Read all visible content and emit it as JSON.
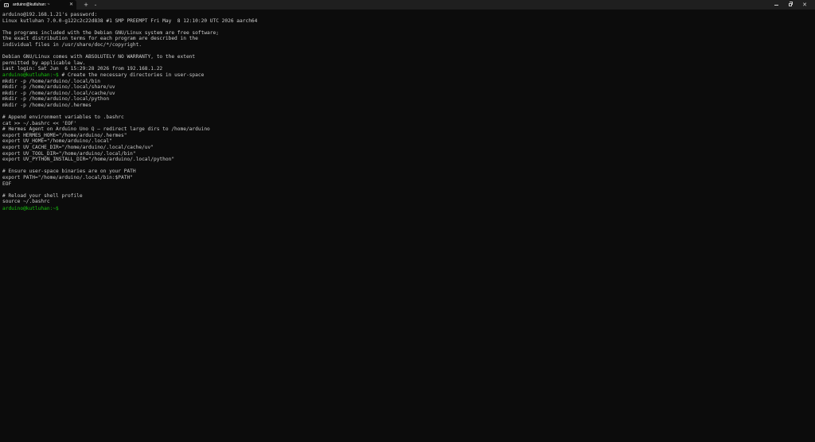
{
  "tab": {
    "title": "arduino@kutluhan: ~",
    "close_glyph": "✕",
    "icon": "terminal-icon"
  },
  "titlebar": {
    "new_tab_glyph": "+",
    "dropdown_glyph": "⌄",
    "close_glyph": "✕"
  },
  "terminal": {
    "lines": [
      {
        "prompt": "",
        "text": "arduino@192.168.1.21's password:"
      },
      {
        "prompt": "",
        "text": "Linux kutluhan 7.0.0-g122c2c22d838 #1 SMP PREEMPT Fri May  8 12:10:20 UTC 2026 aarch64"
      },
      {
        "prompt": "",
        "text": ""
      },
      {
        "prompt": "",
        "text": "The programs included with the Debian GNU/Linux system are free software;"
      },
      {
        "prompt": "",
        "text": "the exact distribution terms for each program are described in the"
      },
      {
        "prompt": "",
        "text": "individual files in /usr/share/doc/*/copyright."
      },
      {
        "prompt": "",
        "text": ""
      },
      {
        "prompt": "",
        "text": "Debian GNU/Linux comes with ABSOLUTELY NO WARRANTY, to the extent"
      },
      {
        "prompt": "",
        "text": "permitted by applicable law."
      },
      {
        "prompt": "",
        "text": "Last login: Sat Jun  6 15:29:28 2026 from 192.168.1.22"
      },
      {
        "prompt": "arduino@kutluhan:~$",
        "text": " # Create the necessary directories in user-space"
      },
      {
        "prompt": "",
        "text": "mkdir -p /home/arduino/.local/bin"
      },
      {
        "prompt": "",
        "text": "mkdir -p /home/arduino/.local/share/uv"
      },
      {
        "prompt": "",
        "text": "mkdir -p /home/arduino/.local/cache/uv"
      },
      {
        "prompt": "",
        "text": "mkdir -p /home/arduino/.local/python"
      },
      {
        "prompt": "",
        "text": "mkdir -p /home/arduino/.hermes"
      },
      {
        "prompt": "",
        "text": ""
      },
      {
        "prompt": "",
        "text": "# Append environment variables to .bashrc"
      },
      {
        "prompt": "",
        "text": "cat >> ~/.bashrc << 'EOF'"
      },
      {
        "prompt": "",
        "text": "# Hermes Agent on Arduino Uno Q — redirect large dirs to /home/arduino"
      },
      {
        "prompt": "",
        "text": "export HERMES_HOME=\"/home/arduino/.hermes\""
      },
      {
        "prompt": "",
        "text": "export UV_HOME=\"/home/arduino/.local\""
      },
      {
        "prompt": "",
        "text": "export UV_CACHE_DIR=\"/home/arduino/.local/cache/uv\""
      },
      {
        "prompt": "",
        "text": "export UV_TOOL_DIR=\"/home/arduino/.local/bin\""
      },
      {
        "prompt": "",
        "text": "export UV_PYTHON_INSTALL_DIR=\"/home/arduino/.local/python\""
      },
      {
        "prompt": "",
        "text": ""
      },
      {
        "prompt": "",
        "text": "# Ensure user-space binaries are on your PATH"
      },
      {
        "prompt": "",
        "text": "export PATH=\"/home/arduino/.local/bin:$PATH\""
      },
      {
        "prompt": "",
        "text": "EOF"
      },
      {
        "prompt": "",
        "text": ""
      },
      {
        "prompt": "",
        "text": "# Reload your shell profile"
      },
      {
        "prompt": "",
        "text": "source ~/.bashrc"
      },
      {
        "prompt": "arduino@kutluhan:~$",
        "text": ""
      }
    ]
  },
  "colors": {
    "background": "#0c0c0c",
    "text": "#cccccc",
    "prompt": "#16c60c",
    "titlebar": "#1f1f1f"
  }
}
